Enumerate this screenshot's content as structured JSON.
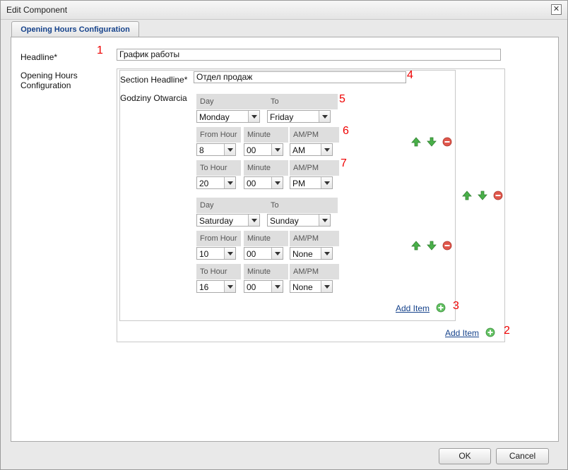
{
  "window": {
    "title": "Edit Component",
    "close": "✕"
  },
  "tab": {
    "label": "Opening Hours Configuration"
  },
  "form": {
    "headline_label": "Headline*",
    "headline_value": "График работы",
    "ohc_label_1": "Opening Hours",
    "ohc_label_2": "Configuration",
    "section_headline_label": "Section Headline*",
    "section_headline_value": "Отдел продаж",
    "godziny_label": "Godziny Otwarcia"
  },
  "entries": [
    {
      "day_label": "Day",
      "to_label": "To",
      "day": "Monday",
      "to": "Friday",
      "from_hour_label": "From Hour",
      "minute_label": "Minute",
      "ampm_label": "AM/PM",
      "from_hour": "8",
      "from_minute": "00",
      "from_ampm": "AM",
      "to_hour_label": "To Hour",
      "to_hour": "20",
      "to_minute": "00",
      "to_ampm": "PM"
    },
    {
      "day_label": "Day",
      "to_label": "To",
      "day": "Saturday",
      "to": "Sunday",
      "from_hour_label": "From Hour",
      "minute_label": "Minute",
      "ampm_label": "AM/PM",
      "from_hour": "10",
      "from_minute": "00",
      "from_ampm": "None",
      "to_hour_label": "To Hour",
      "to_hour": "16",
      "to_minute": "00",
      "to_ampm": "None"
    }
  ],
  "links": {
    "add_item_inner": "Add Item",
    "add_item_outer": "Add Item"
  },
  "annotations": [
    "1",
    "2",
    "3",
    "4",
    "5",
    "6",
    "7"
  ],
  "buttons": {
    "ok": "OK",
    "cancel": "Cancel"
  },
  "background": {
    "c1": "a",
    "c2": "a",
    "c3": "s",
    "c4": "t"
  },
  "colors": {
    "link": "#15428b",
    "annotation": "#e00000",
    "up_arrow": "#3aa53a",
    "remove": "#d9463c"
  }
}
